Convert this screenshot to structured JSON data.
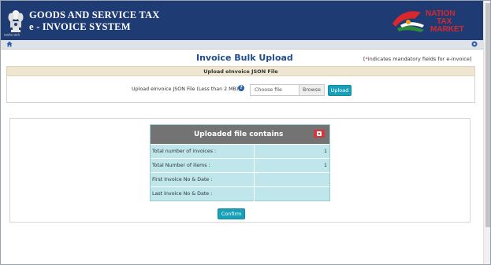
{
  "header": {
    "title_line1": "GOODS AND SERVICE TAX",
    "title_line2": "e - INVOICE SYSTEM",
    "emblem_motto": "सत्यमेव जयते",
    "logo_text": [
      "NATION",
      "TAX",
      "MARKET"
    ],
    "background_color": "#1e3c73"
  },
  "nav": {
    "home_icon": "home-icon",
    "right_icon": "settings-icon"
  },
  "page": {
    "title": "Invoice Bulk Upload",
    "mandatory_prefix": "[",
    "mandatory_star": "*",
    "mandatory_text": "indicates mandatory fields for e-invoice]"
  },
  "upload_section": {
    "heading": "Upload eInvoice JSON File",
    "field_label": "Upload eInvoice JSON File (Less than 2 MB):",
    "help_icon": "?",
    "file_placeholder": "Choose file",
    "browse_label": "Browse",
    "upload_label": "Upload"
  },
  "result": {
    "heading": "Uploaded file contains",
    "rows": [
      {
        "label": "Total number of invoices :",
        "value": "1"
      },
      {
        "label": "Total Number of items :",
        "value": "1"
      },
      {
        "label": "First Invoice No & Date :",
        "value": ""
      },
      {
        "label": "Last Invoice No & Date :",
        "value": ""
      }
    ],
    "confirm_label": "Confirm"
  },
  "colors": {
    "accent": "#19a0b9",
    "title_blue": "#1e4d8c",
    "table_row": "#bfe6ea",
    "close_red": "#d9343a"
  }
}
